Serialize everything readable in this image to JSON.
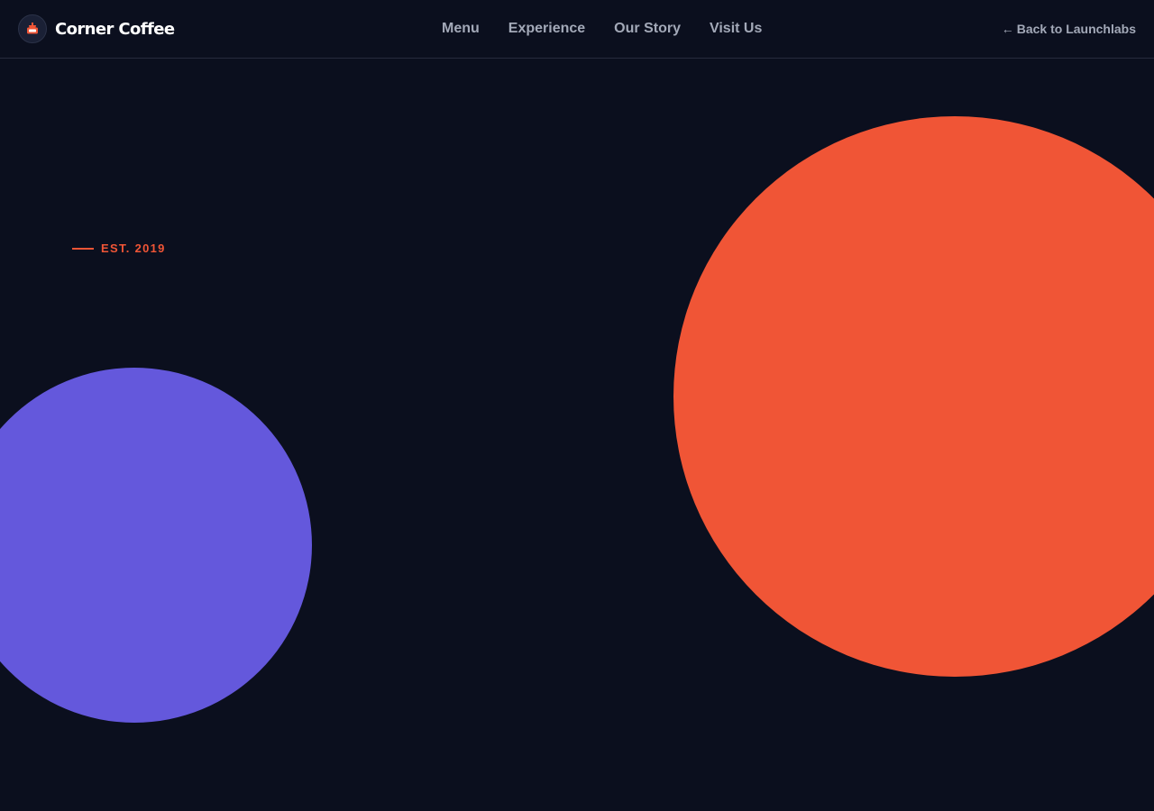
{
  "header": {
    "brand_name": "Corner Coffee",
    "brand_icon": "coffee-cup-icon",
    "nav": [
      {
        "label": "Menu"
      },
      {
        "label": "Experience"
      },
      {
        "label": "Our Story"
      },
      {
        "label": "Visit Us"
      }
    ],
    "back_link": {
      "arrow": "←",
      "label": "Back to Launchlabs"
    }
  },
  "hero": {
    "eyebrow": "EST. 2019"
  },
  "colors": {
    "background": "#0b0f1e",
    "accent_orange": "#f05536",
    "accent_purple": "#6458dc",
    "nav_text": "#a3a9b8",
    "brand_text": "#ffffff"
  }
}
